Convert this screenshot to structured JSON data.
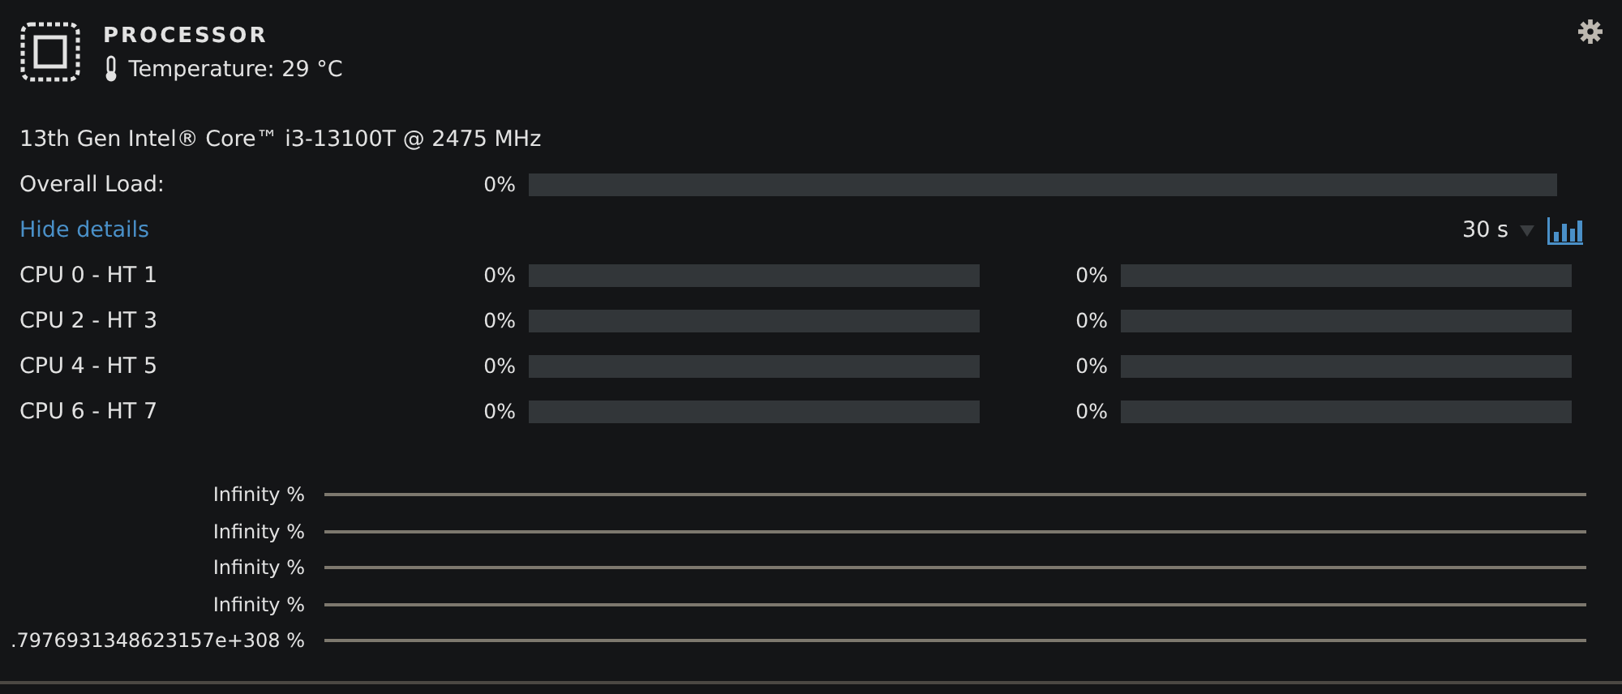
{
  "header": {
    "title": "PROCESSOR",
    "temperature": "Temperature: 29 °C"
  },
  "cpu_name": "13th Gen Intel® Core™ i3-13100T @ 2475 MHz",
  "overall": {
    "label": "Overall Load:",
    "reading": "0%",
    "level": 0
  },
  "details_link": "Hide details",
  "interval": "30 s",
  "cores": [
    {
      "label": "CPU 0 - HT 1",
      "threads": [
        {
          "reading": "0%",
          "level": 0
        },
        {
          "reading": "0%",
          "level": 0
        }
      ]
    },
    {
      "label": "CPU 2 - HT 3",
      "threads": [
        {
          "reading": "0%",
          "level": 0
        },
        {
          "reading": "0%",
          "level": 0
        }
      ]
    },
    {
      "label": "CPU 4 - HT 5",
      "threads": [
        {
          "reading": "0%",
          "level": 0
        },
        {
          "reading": "0%",
          "level": 0
        }
      ]
    },
    {
      "label": "CPU 6 - HT 7",
      "threads": [
        {
          "reading": "0%",
          "level": 0
        },
        {
          "reading": "0%",
          "level": 0
        }
      ]
    }
  ],
  "history_graph": {
    "grid_labels": [
      "Infinity %",
      "Infinity %",
      "Infinity %",
      "Infinity %",
      ".7976931348623157e+308 %"
    ]
  }
}
